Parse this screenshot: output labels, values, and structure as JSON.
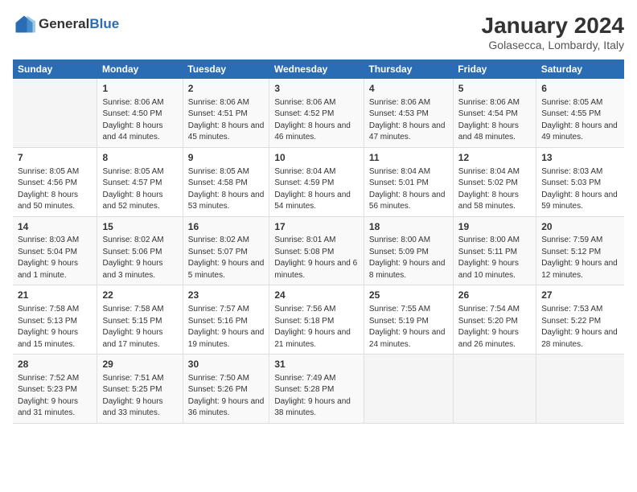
{
  "header": {
    "logo_general": "General",
    "logo_blue": "Blue",
    "month_title": "January 2024",
    "location": "Golasecca, Lombardy, Italy"
  },
  "weekdays": [
    "Sunday",
    "Monday",
    "Tuesday",
    "Wednesday",
    "Thursday",
    "Friday",
    "Saturday"
  ],
  "weeks": [
    [
      {
        "day": "",
        "empty": true
      },
      {
        "day": "1",
        "sunrise": "Sunrise: 8:06 AM",
        "sunset": "Sunset: 4:50 PM",
        "daylight": "Daylight: 8 hours and 44 minutes."
      },
      {
        "day": "2",
        "sunrise": "Sunrise: 8:06 AM",
        "sunset": "Sunset: 4:51 PM",
        "daylight": "Daylight: 8 hours and 45 minutes."
      },
      {
        "day": "3",
        "sunrise": "Sunrise: 8:06 AM",
        "sunset": "Sunset: 4:52 PM",
        "daylight": "Daylight: 8 hours and 46 minutes."
      },
      {
        "day": "4",
        "sunrise": "Sunrise: 8:06 AM",
        "sunset": "Sunset: 4:53 PM",
        "daylight": "Daylight: 8 hours and 47 minutes."
      },
      {
        "day": "5",
        "sunrise": "Sunrise: 8:06 AM",
        "sunset": "Sunset: 4:54 PM",
        "daylight": "Daylight: 8 hours and 48 minutes."
      },
      {
        "day": "6",
        "sunrise": "Sunrise: 8:05 AM",
        "sunset": "Sunset: 4:55 PM",
        "daylight": "Daylight: 8 hours and 49 minutes."
      }
    ],
    [
      {
        "day": "7",
        "sunrise": "Sunrise: 8:05 AM",
        "sunset": "Sunset: 4:56 PM",
        "daylight": "Daylight: 8 hours and 50 minutes."
      },
      {
        "day": "8",
        "sunrise": "Sunrise: 8:05 AM",
        "sunset": "Sunset: 4:57 PM",
        "daylight": "Daylight: 8 hours and 52 minutes."
      },
      {
        "day": "9",
        "sunrise": "Sunrise: 8:05 AM",
        "sunset": "Sunset: 4:58 PM",
        "daylight": "Daylight: 8 hours and 53 minutes."
      },
      {
        "day": "10",
        "sunrise": "Sunrise: 8:04 AM",
        "sunset": "Sunset: 4:59 PM",
        "daylight": "Daylight: 8 hours and 54 minutes."
      },
      {
        "day": "11",
        "sunrise": "Sunrise: 8:04 AM",
        "sunset": "Sunset: 5:01 PM",
        "daylight": "Daylight: 8 hours and 56 minutes."
      },
      {
        "day": "12",
        "sunrise": "Sunrise: 8:04 AM",
        "sunset": "Sunset: 5:02 PM",
        "daylight": "Daylight: 8 hours and 58 minutes."
      },
      {
        "day": "13",
        "sunrise": "Sunrise: 8:03 AM",
        "sunset": "Sunset: 5:03 PM",
        "daylight": "Daylight: 8 hours and 59 minutes."
      }
    ],
    [
      {
        "day": "14",
        "sunrise": "Sunrise: 8:03 AM",
        "sunset": "Sunset: 5:04 PM",
        "daylight": "Daylight: 9 hours and 1 minute."
      },
      {
        "day": "15",
        "sunrise": "Sunrise: 8:02 AM",
        "sunset": "Sunset: 5:06 PM",
        "daylight": "Daylight: 9 hours and 3 minutes."
      },
      {
        "day": "16",
        "sunrise": "Sunrise: 8:02 AM",
        "sunset": "Sunset: 5:07 PM",
        "daylight": "Daylight: 9 hours and 5 minutes."
      },
      {
        "day": "17",
        "sunrise": "Sunrise: 8:01 AM",
        "sunset": "Sunset: 5:08 PM",
        "daylight": "Daylight: 9 hours and 6 minutes."
      },
      {
        "day": "18",
        "sunrise": "Sunrise: 8:00 AM",
        "sunset": "Sunset: 5:09 PM",
        "daylight": "Daylight: 9 hours and 8 minutes."
      },
      {
        "day": "19",
        "sunrise": "Sunrise: 8:00 AM",
        "sunset": "Sunset: 5:11 PM",
        "daylight": "Daylight: 9 hours and 10 minutes."
      },
      {
        "day": "20",
        "sunrise": "Sunrise: 7:59 AM",
        "sunset": "Sunset: 5:12 PM",
        "daylight": "Daylight: 9 hours and 12 minutes."
      }
    ],
    [
      {
        "day": "21",
        "sunrise": "Sunrise: 7:58 AM",
        "sunset": "Sunset: 5:13 PM",
        "daylight": "Daylight: 9 hours and 15 minutes."
      },
      {
        "day": "22",
        "sunrise": "Sunrise: 7:58 AM",
        "sunset": "Sunset: 5:15 PM",
        "daylight": "Daylight: 9 hours and 17 minutes."
      },
      {
        "day": "23",
        "sunrise": "Sunrise: 7:57 AM",
        "sunset": "Sunset: 5:16 PM",
        "daylight": "Daylight: 9 hours and 19 minutes."
      },
      {
        "day": "24",
        "sunrise": "Sunrise: 7:56 AM",
        "sunset": "Sunset: 5:18 PM",
        "daylight": "Daylight: 9 hours and 21 minutes."
      },
      {
        "day": "25",
        "sunrise": "Sunrise: 7:55 AM",
        "sunset": "Sunset: 5:19 PM",
        "daylight": "Daylight: 9 hours and 24 minutes."
      },
      {
        "day": "26",
        "sunrise": "Sunrise: 7:54 AM",
        "sunset": "Sunset: 5:20 PM",
        "daylight": "Daylight: 9 hours and 26 minutes."
      },
      {
        "day": "27",
        "sunrise": "Sunrise: 7:53 AM",
        "sunset": "Sunset: 5:22 PM",
        "daylight": "Daylight: 9 hours and 28 minutes."
      }
    ],
    [
      {
        "day": "28",
        "sunrise": "Sunrise: 7:52 AM",
        "sunset": "Sunset: 5:23 PM",
        "daylight": "Daylight: 9 hours and 31 minutes."
      },
      {
        "day": "29",
        "sunrise": "Sunrise: 7:51 AM",
        "sunset": "Sunset: 5:25 PM",
        "daylight": "Daylight: 9 hours and 33 minutes."
      },
      {
        "day": "30",
        "sunrise": "Sunrise: 7:50 AM",
        "sunset": "Sunset: 5:26 PM",
        "daylight": "Daylight: 9 hours and 36 minutes."
      },
      {
        "day": "31",
        "sunrise": "Sunrise: 7:49 AM",
        "sunset": "Sunset: 5:28 PM",
        "daylight": "Daylight: 9 hours and 38 minutes."
      },
      {
        "day": "",
        "empty": true
      },
      {
        "day": "",
        "empty": true
      },
      {
        "day": "",
        "empty": true
      }
    ]
  ]
}
